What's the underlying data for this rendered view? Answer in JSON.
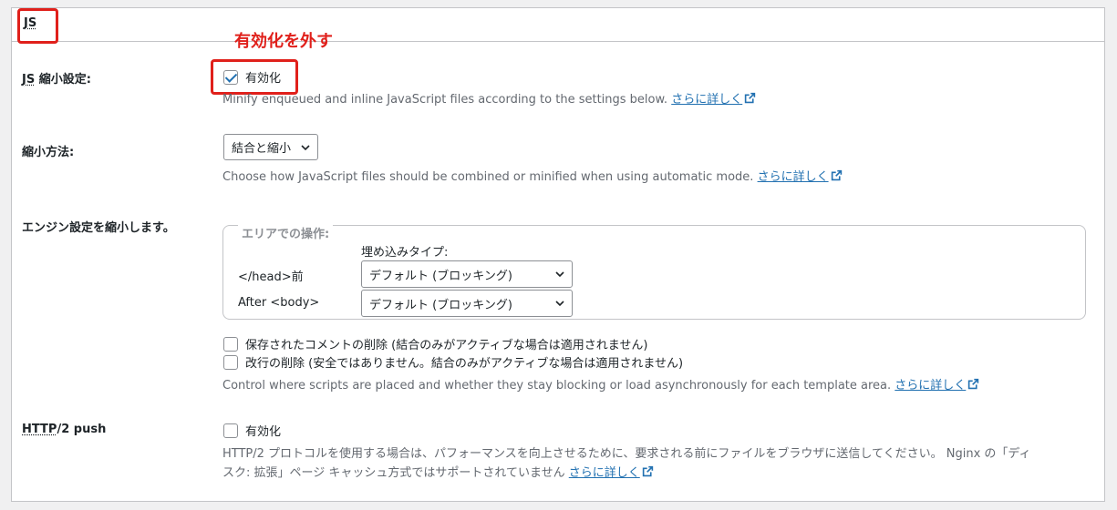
{
  "header": {
    "title": "JS"
  },
  "annotation": {
    "note": "有効化を外す",
    "color": "#e0201b"
  },
  "minify": {
    "label": "JS 縮小設定:",
    "checkbox_label": "有効化",
    "checked": true,
    "description": "Minify enqueued and inline JavaScript files according to the settings below.",
    "link": "さらに詳しく"
  },
  "method": {
    "label": "縮小方法:",
    "selected": "結合と縮小",
    "description": "Choose how JavaScript files should be combined or minified when using automatic mode.",
    "link": "さらに詳しく"
  },
  "engine": {
    "label": "エンジン設定を縮小します。",
    "legend": "エリアでの操作:",
    "column_header": "埋め込みタイプ:",
    "rows": [
      {
        "label": "</head>前",
        "value": "デフォルト (ブロッキング)"
      },
      {
        "label": "After <body>",
        "value": "デフォルト (ブロッキング)"
      }
    ],
    "options": [
      {
        "label": "保存されたコメントの削除 (結合のみがアクティブな場合は適用されません)",
        "checked": false
      },
      {
        "label": "改行の削除 (安全ではありません。結合のみがアクティブな場合は適用されません)",
        "checked": false
      }
    ],
    "description": "Control where scripts are placed and whether they stay blocking or load asynchronously for each template area.",
    "link": "さらに詳しく"
  },
  "http2": {
    "label": "HTTP/2 push",
    "checkbox_label": "有効化",
    "checked": false,
    "description_line1": "HTTP/2 プロトコルを使用する場合は、パフォーマンスを向上させるために、要求される前にファイルをブラウザに送信してください。 Nginx の「ディ",
    "description_line2": "スク: 拡張」ページ キャッシュ方式ではサポートされていません",
    "link": "さらに詳しく"
  },
  "colors": {
    "link": "#2271b1",
    "accent_red": "#e0201b",
    "border": "#c3c4c7"
  }
}
